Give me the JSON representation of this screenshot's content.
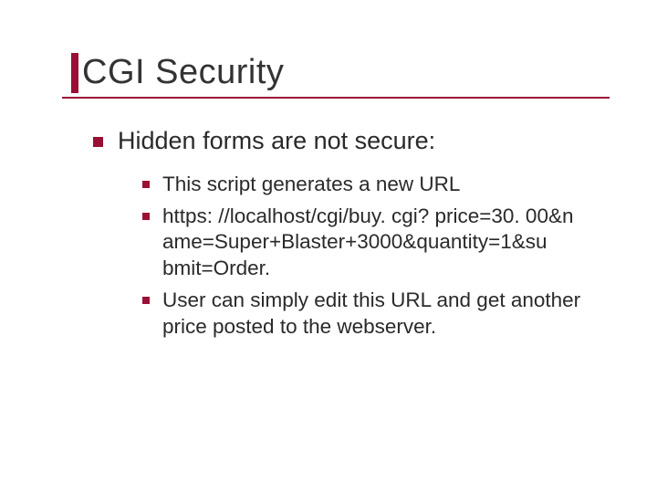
{
  "title": "CGI Security",
  "bullet_lv1": "Hidden forms are not secure:",
  "sub_bullets": [
    "This script generates a new URL",
    "https: //localhost/cgi/buy. cgi? price=30. 00&n ame=Super+Blaster+3000&quantity=1&su bmit=Order.",
    "User can simply edit this URL and get another price posted to the webserver."
  ]
}
